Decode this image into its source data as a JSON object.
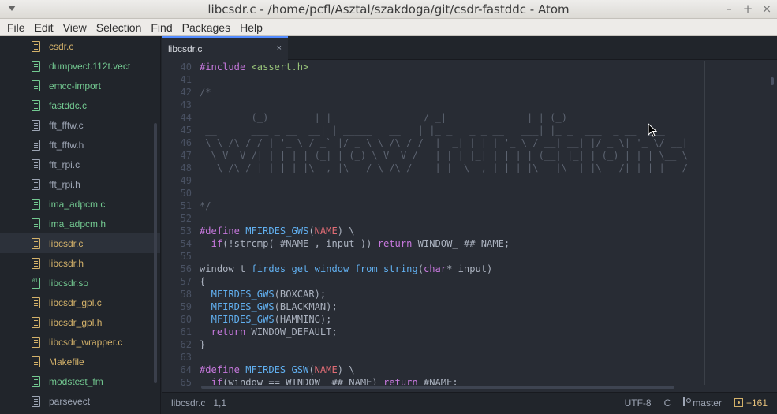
{
  "window": {
    "title": "libcsdr.c - /home/pcfl/Asztal/szakdoga/git/csdr-fastddc - Atom",
    "buttons": [
      "–",
      "+",
      "×"
    ]
  },
  "menu": [
    "File",
    "Edit",
    "View",
    "Selection",
    "Find",
    "Packages",
    "Help"
  ],
  "tree": {
    "items": [
      {
        "label": "csdr.c",
        "color": "yellow",
        "icon": "file-text-icon"
      },
      {
        "label": "dumpvect.112t.vect",
        "color": "green",
        "icon": "file-text-icon"
      },
      {
        "label": "emcc-import",
        "color": "green",
        "icon": "file-text-icon"
      },
      {
        "label": "fastddc.c",
        "color": "green",
        "icon": "file-text-icon"
      },
      {
        "label": "fft_fftw.c",
        "color": "gray",
        "icon": "file-text-icon"
      },
      {
        "label": "fft_fftw.h",
        "color": "gray",
        "icon": "file-text-icon"
      },
      {
        "label": "fft_rpi.c",
        "color": "gray",
        "icon": "file-text-icon"
      },
      {
        "label": "fft_rpi.h",
        "color": "gray",
        "icon": "file-text-icon"
      },
      {
        "label": "ima_adpcm.c",
        "color": "green",
        "icon": "file-text-icon"
      },
      {
        "label": "ima_adpcm.h",
        "color": "green",
        "icon": "file-text-icon"
      },
      {
        "label": "libcsdr.c",
        "color": "yellow",
        "icon": "file-text-icon",
        "selected": true
      },
      {
        "label": "libcsdr.h",
        "color": "yellow",
        "icon": "file-text-icon"
      },
      {
        "label": "libcsdr.so",
        "color": "green",
        "icon": "file-binary-icon"
      },
      {
        "label": "libcsdr_gpl.c",
        "color": "yellow",
        "icon": "file-text-icon"
      },
      {
        "label": "libcsdr_gpl.h",
        "color": "yellow",
        "icon": "file-text-icon"
      },
      {
        "label": "libcsdr_wrapper.c",
        "color": "yellow",
        "icon": "file-text-icon"
      },
      {
        "label": "Makefile",
        "color": "yellow",
        "icon": "file-text-icon"
      },
      {
        "label": "modstest_fm",
        "color": "green",
        "icon": "file-text-icon"
      },
      {
        "label": "parsevect",
        "color": "gray",
        "icon": "file-text-icon"
      }
    ]
  },
  "tab": {
    "label": "libcsdr.c",
    "close": "×"
  },
  "code": {
    "lines": [
      {
        "n": "40",
        "segs": [
          [
            "c-kw",
            "#include "
          ],
          [
            "c-str",
            "<assert.h>"
          ]
        ]
      },
      {
        "n": "41",
        "segs": []
      },
      {
        "n": "42",
        "segs": [
          [
            "c-comment",
            "/*"
          ]
        ]
      },
      {
        "n": "43",
        "segs": [
          [
            "c-comment",
            "          _          _                  __                _   _"
          ]
        ]
      },
      {
        "n": "44",
        "segs": [
          [
            "c-comment",
            "         (_)        | |                / _|              | | (_)"
          ]
        ]
      },
      {
        "n": "45",
        "segs": [
          [
            "c-comment",
            " __      ___ _ __  __| | _____   __   | |_ _   _ _ __   ___| |_ _  ___  _ __  ___"
          ]
        ]
      },
      {
        "n": "46",
        "segs": [
          [
            "c-comment",
            " \\ \\ /\\ / / | '_ \\ / _` |/ _ \\ \\ /\\ / /  |  _| | | | '_ \\ / __| __| |/ _ \\| '_ \\/ __|"
          ]
        ]
      },
      {
        "n": "47",
        "segs": [
          [
            "c-comment",
            "  \\ V  V /| | | | | (_| | (_) \\ V  V /   | | | |_| | | | | (__| |_| | (_) | | | \\__ \\"
          ]
        ]
      },
      {
        "n": "48",
        "segs": [
          [
            "c-comment",
            "   \\_/\\_/ |_|_| |_|\\__,_|\\___/ \\_/\\_/    |_|  \\__,_|_| |_|\\___|\\__|_|\\___/|_| |_|___/"
          ]
        ]
      },
      {
        "n": "49",
        "segs": []
      },
      {
        "n": "50",
        "segs": []
      },
      {
        "n": "51",
        "segs": [
          [
            "c-comment",
            "*/"
          ]
        ]
      },
      {
        "n": "52",
        "segs": []
      },
      {
        "n": "53",
        "segs": [
          [
            "c-kw",
            "#define "
          ],
          [
            "c-macro",
            "MFIRDES_GWS"
          ],
          [
            "c-plain",
            "("
          ],
          [
            "c-param",
            "NAME"
          ],
          [
            "c-plain",
            ") \\"
          ]
        ]
      },
      {
        "n": "54",
        "segs": [
          [
            "c-plain",
            "  "
          ],
          [
            "c-kw",
            "if"
          ],
          [
            "c-plain",
            "(!strcmp( #NAME , input )) "
          ],
          [
            "c-kw",
            "return"
          ],
          [
            "c-plain",
            " WINDOW_ ## NAME;"
          ]
        ]
      },
      {
        "n": "55",
        "segs": []
      },
      {
        "n": "56",
        "segs": [
          [
            "c-plain",
            "window_t "
          ],
          [
            "c-macro",
            "firdes_get_window_from_string"
          ],
          [
            "c-plain",
            "("
          ],
          [
            "c-type",
            "char"
          ],
          [
            "c-plain",
            "* input)"
          ]
        ]
      },
      {
        "n": "57",
        "segs": [
          [
            "c-plain",
            "{"
          ]
        ]
      },
      {
        "n": "58",
        "segs": [
          [
            "c-plain",
            "  "
          ],
          [
            "c-macro",
            "MFIRDES_GWS"
          ],
          [
            "c-plain",
            "(BOXCAR);"
          ]
        ]
      },
      {
        "n": "59",
        "segs": [
          [
            "c-plain",
            "  "
          ],
          [
            "c-macro",
            "MFIRDES_GWS"
          ],
          [
            "c-plain",
            "(BLACKMAN);"
          ]
        ]
      },
      {
        "n": "60",
        "segs": [
          [
            "c-plain",
            "  "
          ],
          [
            "c-macro",
            "MFIRDES_GWS"
          ],
          [
            "c-plain",
            "(HAMMING);"
          ]
        ]
      },
      {
        "n": "61",
        "segs": [
          [
            "c-plain",
            "  "
          ],
          [
            "c-kw",
            "return"
          ],
          [
            "c-plain",
            " WINDOW_DEFAULT;"
          ]
        ]
      },
      {
        "n": "62",
        "segs": [
          [
            "c-plain",
            "}"
          ]
        ]
      },
      {
        "n": "63",
        "segs": []
      },
      {
        "n": "64",
        "segs": [
          [
            "c-kw",
            "#define "
          ],
          [
            "c-macro",
            "MFIRDES_GSW"
          ],
          [
            "c-plain",
            "("
          ],
          [
            "c-param",
            "NAME"
          ],
          [
            "c-plain",
            ") \\"
          ]
        ]
      },
      {
        "n": "65",
        "segs": [
          [
            "c-plain",
            "  "
          ],
          [
            "c-kw",
            "if"
          ],
          [
            "c-plain",
            "(window == WINDOW_ ## NAME) "
          ],
          [
            "c-kw",
            "return"
          ],
          [
            "c-plain",
            " #NAME;"
          ]
        ]
      }
    ]
  },
  "status": {
    "file": "libcsdr.c",
    "cursor": "1,1",
    "encoding": "UTF-8",
    "grammar": "C",
    "branch": "master",
    "diff": "+161"
  }
}
